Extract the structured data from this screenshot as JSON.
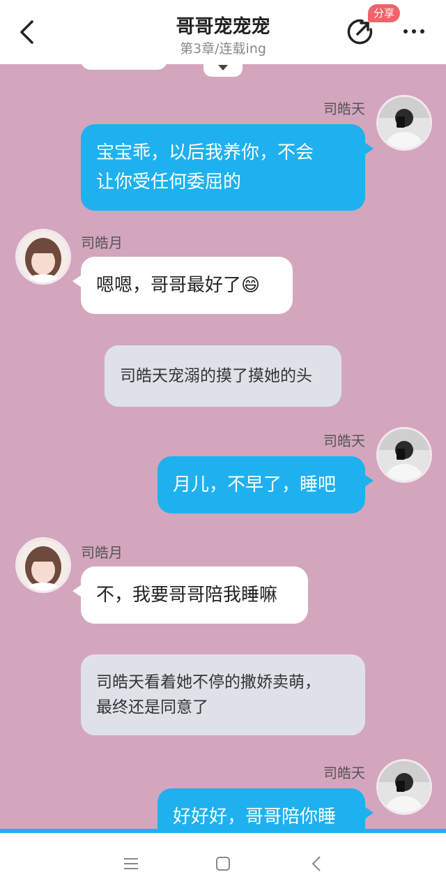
{
  "header": {
    "title": "哥哥宠宠宠",
    "subtitle": "第3章/连载ing",
    "share_badge": "分享",
    "icons": {
      "back": "chevron-left-icon",
      "share": "share-icon",
      "more": "more-dots-icon"
    }
  },
  "characters": {
    "brother": "司皓天",
    "sister": "司皓月"
  },
  "messages": [
    {
      "type": "right",
      "sender": "司皓天",
      "lines": [
        "宝宝乖，以后我养你，不会",
        "让你受任何委屈的"
      ]
    },
    {
      "type": "left",
      "sender": "司皓月",
      "lines": [
        "嗯嗯，哥哥最好了😄"
      ]
    },
    {
      "type": "narration",
      "lines": [
        "司皓天宠溺的摸了摸她的头"
      ]
    },
    {
      "type": "right",
      "sender": "司皓天",
      "lines": [
        "月儿，不早了，睡吧"
      ]
    },
    {
      "type": "left",
      "sender": "司皓月",
      "lines": [
        "不，我要哥哥陪我睡嘛"
      ]
    },
    {
      "type": "narration",
      "lines": [
        "司皓天看着她不停的撒娇卖萌，",
        "最终还是同意了"
      ]
    },
    {
      "type": "right",
      "sender": "司皓天",
      "lines": [
        "好好好，哥哥陪你睡"
      ]
    }
  ],
  "colors": {
    "chat_bg": "#d3a6bd",
    "right_bubble": "#1fb1ef",
    "left_bubble": "#ffffff",
    "narration": "#dfe1e9",
    "badge": "#f0636b"
  },
  "nav": {
    "icons": [
      "menu-icon",
      "home-square-icon",
      "back-triangle-icon"
    ]
  }
}
